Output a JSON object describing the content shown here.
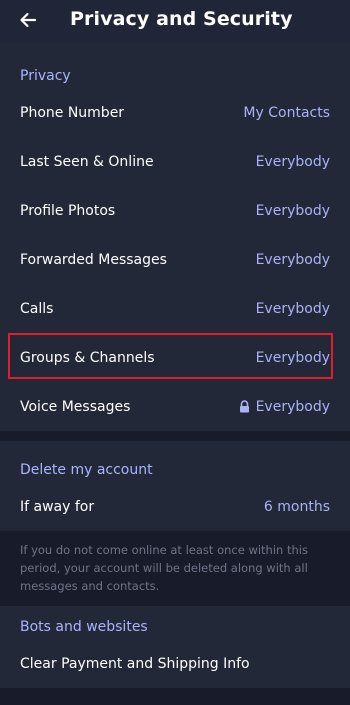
{
  "header": {
    "title": "Privacy and Security",
    "back_icon": "arrow-left-icon"
  },
  "privacy": {
    "section_title": "Privacy",
    "items": [
      {
        "label": "Phone Number",
        "value": "My Contacts"
      },
      {
        "label": "Last Seen & Online",
        "value": "Everybody"
      },
      {
        "label": "Profile Photos",
        "value": "Everybody"
      },
      {
        "label": "Forwarded Messages",
        "value": "Everybody"
      },
      {
        "label": "Calls",
        "value": "Everybody"
      },
      {
        "label": "Groups & Channels",
        "value": "Everybody"
      },
      {
        "label": "Voice Messages",
        "value": "Everybody",
        "icon": "lock-icon"
      }
    ]
  },
  "delete_account": {
    "section_title": "Delete my account",
    "label": "If away for",
    "value": "6 months",
    "info": "If you do not come online at least once within this period, your account will be deleted along with all messages and contacts."
  },
  "bots": {
    "section_title": "Bots and websites",
    "item": "Clear Payment and Shipping Info"
  },
  "colors": {
    "accent": "#a8b2f5",
    "highlight": "#e11d2a",
    "background": "#181c2a",
    "section": "#232838"
  }
}
